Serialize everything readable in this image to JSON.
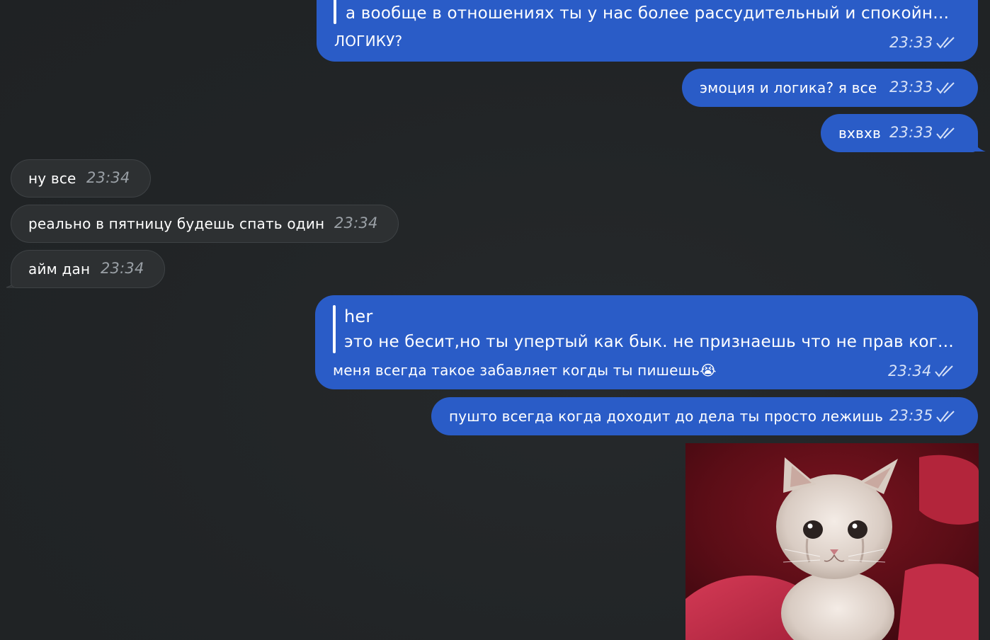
{
  "messages": [
    {
      "reply_text": "а вообще в отношениях ты у нас более рассудительный и спокойн…",
      "text": "ЛОГИКУ?",
      "time": "23:33"
    },
    {
      "text": "эмоция и логика? я все",
      "time": "23:33"
    },
    {
      "text": "вхвхв",
      "time": "23:33"
    },
    {
      "text": "ну все",
      "time": "23:34"
    },
    {
      "text": "реально в пятницу будешь спать один",
      "time": "23:34"
    },
    {
      "text": "айм дан",
      "time": "23:34"
    },
    {
      "reply_author": "her",
      "reply_text": "это не бесит,но ты упертый как бык. не признаешь что не прав ког…",
      "text": "меня всегда такое забавляет когды ты пишешь",
      "emoji": "😭",
      "time": "23:34"
    },
    {
      "text": "пушто всегда когда доходит до дела ты просто лежишь",
      "time": "23:35"
    },
    {
      "media": "crying-kitten-photo"
    }
  ],
  "colors": {
    "outgoing_bubble": "#2a5cc7",
    "incoming_bubble": "#2d3032",
    "background": "#222527"
  }
}
